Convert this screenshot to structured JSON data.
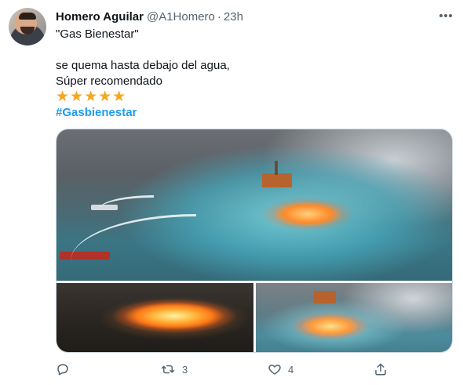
{
  "tweet": {
    "author": {
      "display_name": "Homero Aguilar",
      "handle": "@A1Homero",
      "separator": "·",
      "time": "23h"
    },
    "text": {
      "line1": "\"Gas Bienestar\"",
      "line2": "se quema hasta debajo del agua,",
      "line3": "Súper recomendado",
      "stars": "★★★★★",
      "hashtag": "#Gasbienestar"
    },
    "media": {
      "photo_count": 3
    },
    "actions": {
      "reply_icon": "reply-icon",
      "retweet_icon": "retweet-icon",
      "retweet_count": "3",
      "like_icon": "like-icon",
      "like_count": "4",
      "share_icon": "share-icon"
    }
  },
  "colors": {
    "text": "#0f1419",
    "secondary": "#536471",
    "link": "#1d9bf0",
    "star": "#f5a623",
    "border": "#cfd9de"
  }
}
